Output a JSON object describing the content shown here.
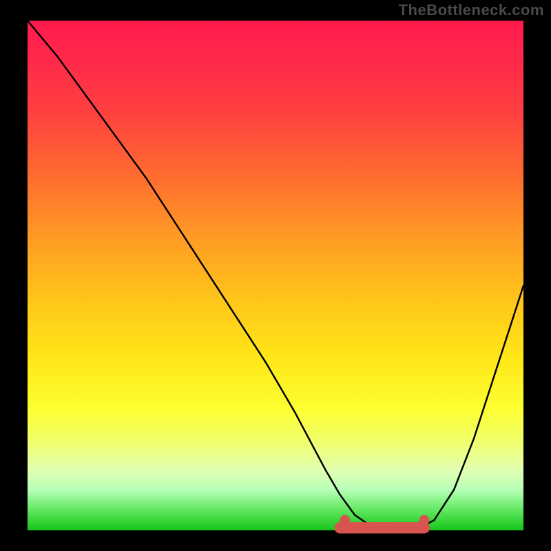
{
  "watermark": "TheBottleneck.com",
  "chart_data": {
    "type": "line",
    "title": "",
    "xlabel": "",
    "ylabel": "",
    "xlim": [
      0,
      100
    ],
    "ylim": [
      0,
      100
    ],
    "series": [
      {
        "name": "curve",
        "x": [
          0,
          6,
          12,
          18,
          24,
          30,
          36,
          42,
          48,
          54,
          60,
          63,
          66,
          69,
          72,
          75,
          78,
          82,
          86,
          90,
          94,
          98,
          100
        ],
        "y": [
          100,
          93,
          85,
          77,
          69,
          60,
          51,
          42,
          33,
          23,
          12,
          7,
          3,
          1,
          0,
          0,
          0,
          2,
          8,
          18,
          30,
          42,
          48
        ]
      }
    ],
    "markers": [
      {
        "name": "trough-marker-left",
        "x": 64,
        "y": 2,
        "r": 1.0,
        "color": "#d9534f"
      },
      {
        "name": "trough-marker-right",
        "x": 80,
        "y": 2,
        "r": 1.0,
        "color": "#d9534f"
      }
    ],
    "trough_band": {
      "x0": 63,
      "x1": 80,
      "y": 0.5,
      "thickness": 2.2,
      "color": "#d9534f"
    },
    "gradient_stops": [
      {
        "pct": 0,
        "color": "#ff1a4d"
      },
      {
        "pct": 8,
        "color": "#ff2a4a"
      },
      {
        "pct": 18,
        "color": "#ff4040"
      },
      {
        "pct": 30,
        "color": "#ff6a30"
      },
      {
        "pct": 42,
        "color": "#ff9925"
      },
      {
        "pct": 54,
        "color": "#ffc31a"
      },
      {
        "pct": 66,
        "color": "#ffe618"
      },
      {
        "pct": 76,
        "color": "#fcff30"
      },
      {
        "pct": 82,
        "color": "#f2ff66"
      },
      {
        "pct": 88,
        "color": "#e2ffb0"
      },
      {
        "pct": 92,
        "color": "#b8ffb8"
      },
      {
        "pct": 96,
        "color": "#60e860"
      },
      {
        "pct": 100,
        "color": "#17c41a"
      }
    ]
  }
}
